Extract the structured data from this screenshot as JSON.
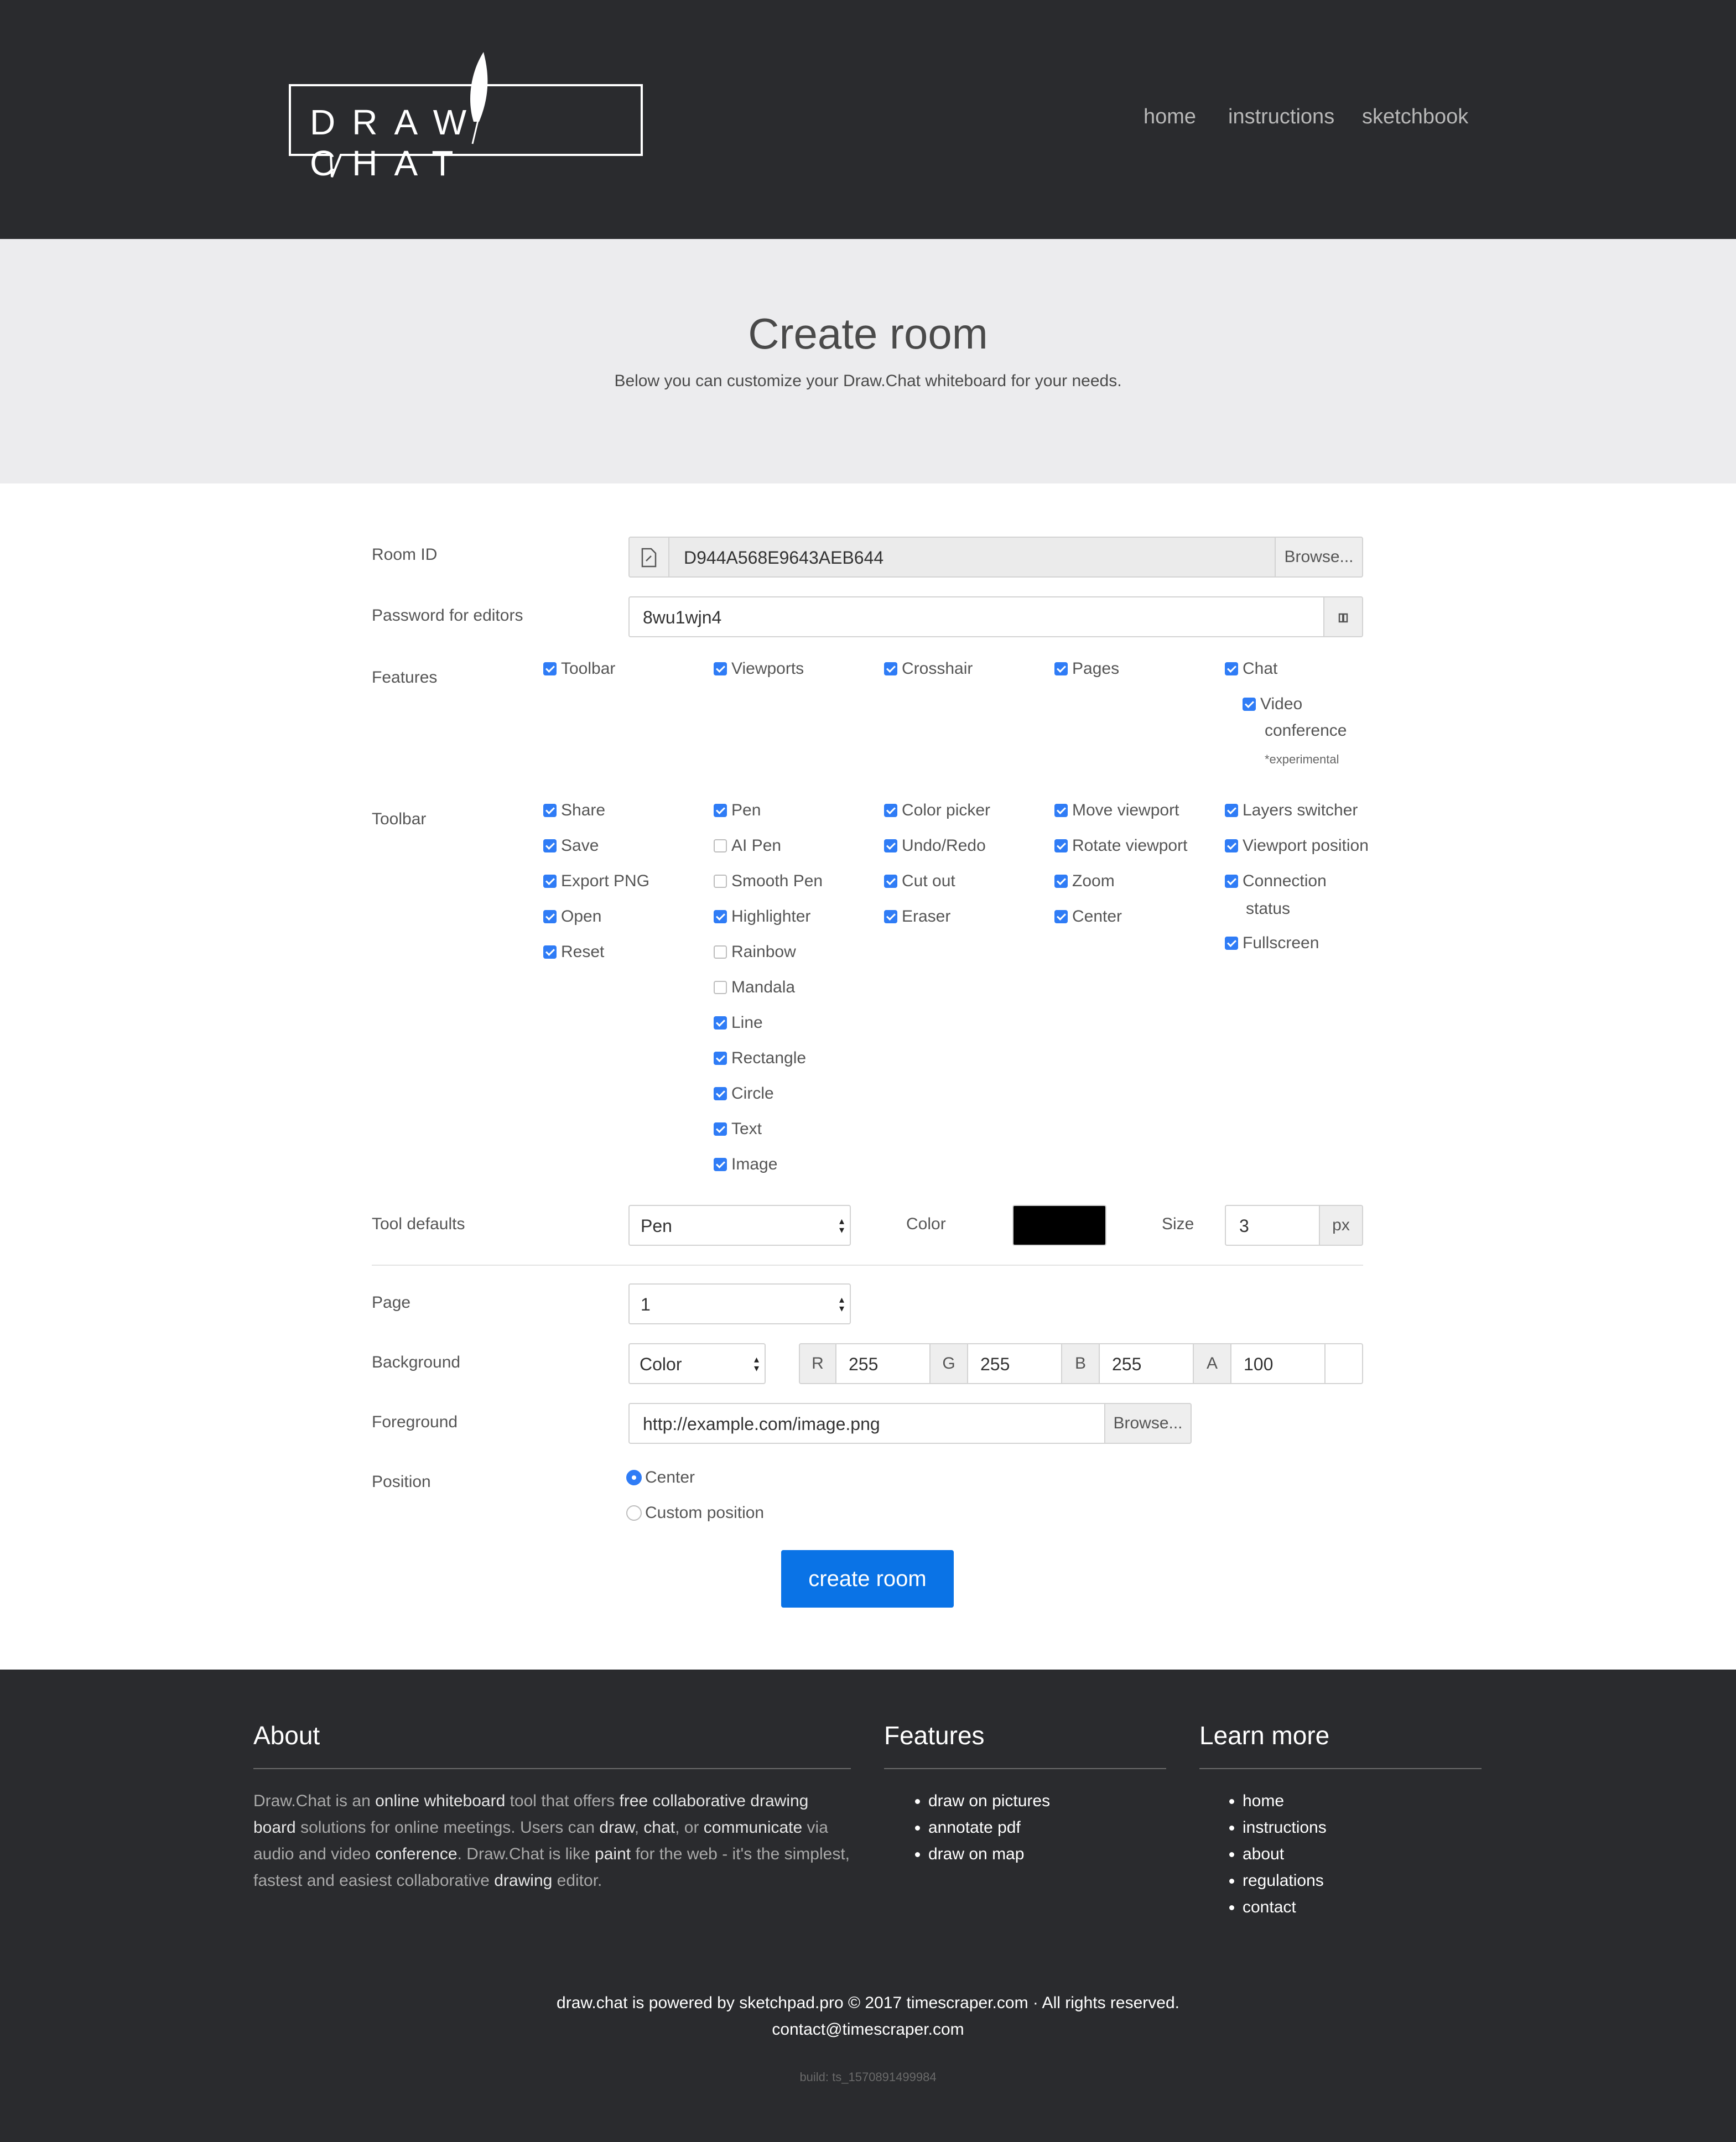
{
  "header": {
    "logo_text": "DRAW CHAT",
    "nav": [
      "home",
      "instructions",
      "sketchbook"
    ]
  },
  "hero": {
    "title": "Create room",
    "subtitle": "Below you can customize your Draw.Chat whiteboard for your needs."
  },
  "form": {
    "room_id": {
      "label": "Room ID",
      "value": "D944A568E9643AEB644",
      "browse": "Browse..."
    },
    "password": {
      "label": "Password for editors",
      "value": "8wu1wjn4"
    },
    "features": {
      "label": "Features",
      "items": [
        {
          "label": "Toolbar",
          "checked": true
        },
        {
          "label": "Viewports",
          "checked": true
        },
        {
          "label": "Crosshair",
          "checked": true
        },
        {
          "label": "Pages",
          "checked": true
        },
        {
          "label": "Chat",
          "checked": true
        }
      ],
      "video": {
        "label1": "Video",
        "label2": "conference",
        "checked": true,
        "note": "*experimental"
      }
    },
    "toolbar": {
      "label": "Toolbar",
      "col1": [
        {
          "label": "Share",
          "checked": true
        },
        {
          "label": "Save",
          "checked": true
        },
        {
          "label": "Export PNG",
          "checked": true
        },
        {
          "label": "Open",
          "checked": true
        },
        {
          "label": "Reset",
          "checked": true
        }
      ],
      "col2": [
        {
          "label": "Pen",
          "checked": true
        },
        {
          "label": "AI Pen",
          "checked": false
        },
        {
          "label": "Smooth Pen",
          "checked": false
        },
        {
          "label": "Highlighter",
          "checked": true
        },
        {
          "label": "Rainbow",
          "checked": false
        },
        {
          "label": "Mandala",
          "checked": false
        },
        {
          "label": "Line",
          "checked": true
        },
        {
          "label": "Rectangle",
          "checked": true
        },
        {
          "label": "Circle",
          "checked": true
        },
        {
          "label": "Text",
          "checked": true
        },
        {
          "label": "Image",
          "checked": true
        }
      ],
      "col3": [
        {
          "label": "Color picker",
          "checked": true
        },
        {
          "label": "Undo/Redo",
          "checked": true
        },
        {
          "label": "Cut out",
          "checked": true
        },
        {
          "label": "Eraser",
          "checked": true
        }
      ],
      "col4": [
        {
          "label": "Move viewport",
          "checked": true
        },
        {
          "label": "Rotate viewport",
          "checked": true
        },
        {
          "label": "Zoom",
          "checked": true
        },
        {
          "label": "Center",
          "checked": true
        }
      ],
      "col5": {
        "layers": {
          "label": "Layers switcher",
          "checked": true
        },
        "viewport": {
          "label": "Viewport position",
          "checked": true
        },
        "connection": {
          "label1": "Connection",
          "label2": "status",
          "checked": true
        },
        "fullscreen": {
          "label": "Fullscreen",
          "checked": true
        }
      }
    },
    "tool_defaults": {
      "label": "Tool defaults",
      "tool": "Pen",
      "color_label": "Color",
      "color": "#000000",
      "size_label": "Size",
      "size": "3",
      "unit": "px"
    },
    "page": {
      "label": "Page",
      "value": "1"
    },
    "background": {
      "label": "Background",
      "mode": "Color",
      "r_label": "R",
      "r": "255",
      "g_label": "G",
      "g": "255",
      "b_label": "B",
      "b": "255",
      "a_label": "A",
      "a": "100"
    },
    "foreground": {
      "label": "Foreground",
      "placeholder": "http://example.com/image.png",
      "browse": "Browse..."
    },
    "position": {
      "label": "Position",
      "options": [
        {
          "label": "Center",
          "selected": true
        },
        {
          "label": "Custom position",
          "selected": false
        }
      ]
    },
    "submit": "create room"
  },
  "footer": {
    "about": {
      "title": "About",
      "p1": "Draw.Chat is an ",
      "b1": "online whiteboard",
      "p2": " tool that offers ",
      "b2": "free collaborative drawing board",
      "p3": " solutions for online meetings. Users can ",
      "b3": "draw",
      "p4": ", ",
      "b4": "chat",
      "p5": ", or ",
      "b5": "communicate",
      "p6": " via audio and video ",
      "b6": "conference",
      "p7": ". Draw.Chat is like ",
      "b7": "paint",
      "p8": " for the web - it's the simplest, fastest and easiest collaborative ",
      "b8": "drawing",
      "p9": " editor."
    },
    "features": {
      "title": "Features",
      "items": [
        "draw on pictures",
        "annotate pdf",
        "draw on map"
      ]
    },
    "learn": {
      "title": "Learn more",
      "items": [
        "home",
        "instructions",
        "about",
        "regulations",
        "contact"
      ]
    },
    "copyright": "draw.chat is powered by sketchpad.pro © 2017 timescraper.com · All rights reserved.",
    "contact": "contact@timescraper.com",
    "build": "build: ts_1570891499984"
  }
}
